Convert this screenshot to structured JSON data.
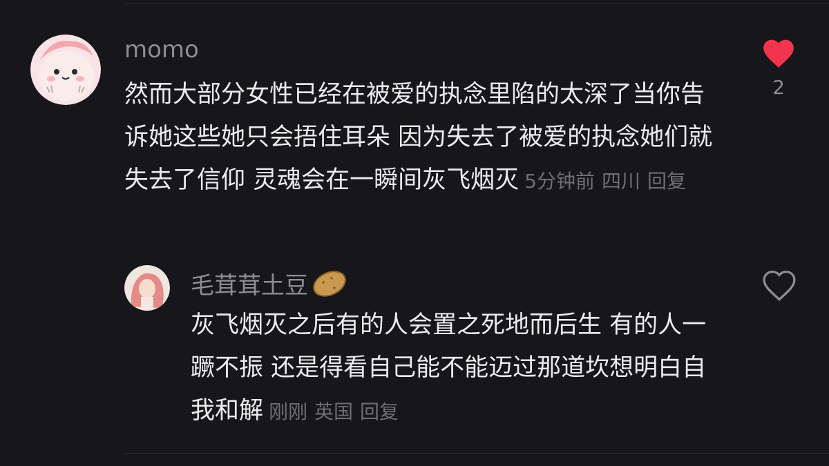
{
  "comments": [
    {
      "username": "momo",
      "text": "然而大部分女性已经在被爱的执念里陷的太深了当你告诉她这些她只会捂住耳朵 因为失去了被爱的执念她们就失去了信仰 灵魂会在一瞬间灰飞烟灭",
      "time": "5分钟前",
      "location": "四川",
      "reply_label": "回复",
      "likes": "2",
      "liked": true,
      "like_color": "#f0354d"
    },
    {
      "username": "毛茸茸土豆",
      "username_emoji": "potato",
      "text": "灰飞烟灭之后有的人会置之死地而后生 有的人一蹶不振 还是得看自己能不能迈过那道坎想明白自我和解",
      "time": "刚刚",
      "location": "英国",
      "reply_label": "回复",
      "liked": false
    }
  ],
  "colors": {
    "background": "#17161b",
    "text": "#ecebef",
    "secondary": "#8d8c93",
    "meta": "#6f6e75",
    "like_active": "#f0354d"
  }
}
